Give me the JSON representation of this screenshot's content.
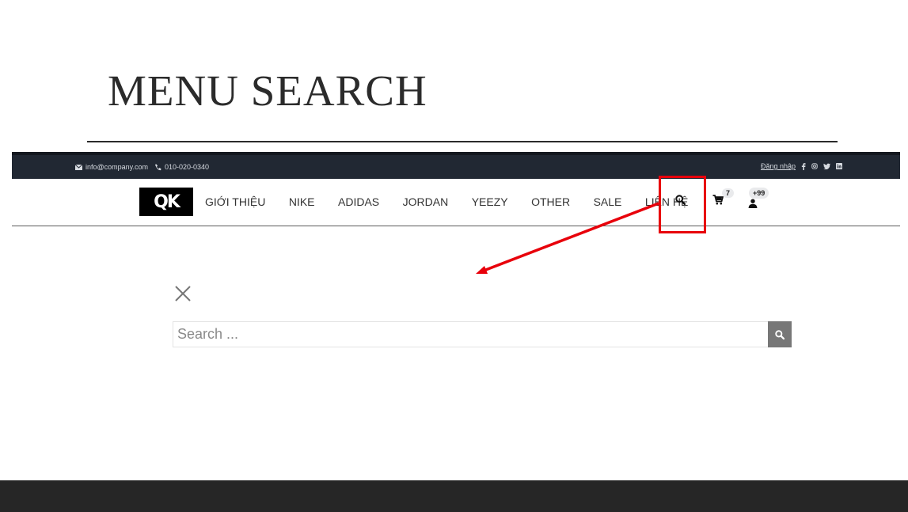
{
  "slide": {
    "title": "MENU SEARCH"
  },
  "topbar": {
    "email": "info@company.com",
    "phone": "010-020-0340",
    "login_label": "Đăng nhập",
    "social_icons": [
      "facebook-icon",
      "instagram-icon",
      "twitter-icon",
      "linkedin-icon"
    ]
  },
  "navbar": {
    "logo_text": "QK",
    "menu": [
      {
        "label": "GIỚI THIỆU"
      },
      {
        "label": "NIKE"
      },
      {
        "label": "ADIDAS"
      },
      {
        "label": "JORDAN"
      },
      {
        "label": "YEEZY"
      },
      {
        "label": "OTHER"
      },
      {
        "label": "SALE"
      },
      {
        "label": "LIÊN HỆ"
      }
    ],
    "cart_count": "7",
    "user_badge": "+99"
  },
  "search": {
    "placeholder": "Search ..."
  },
  "colors": {
    "topbar_bg": "#212833",
    "highlight": "#e8000b",
    "search_button": "#777777",
    "footer_band": "#262626"
  }
}
